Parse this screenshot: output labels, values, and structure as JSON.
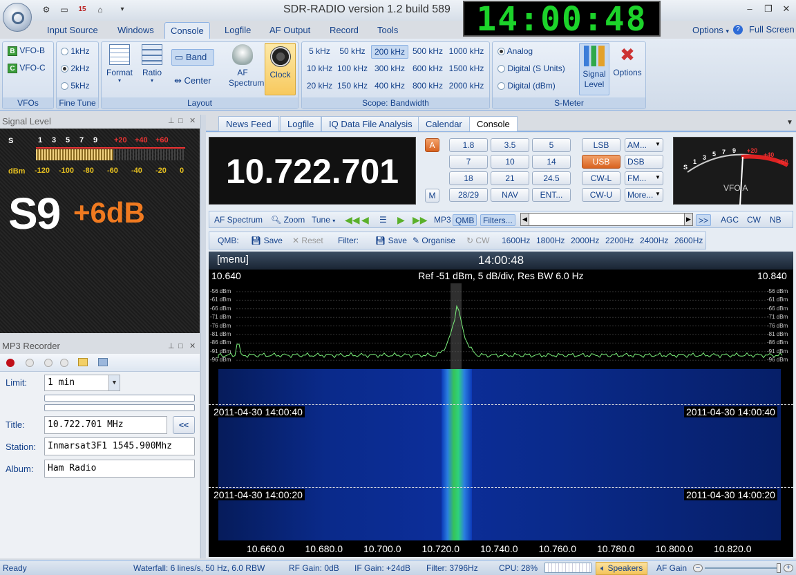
{
  "title_bar": {
    "title": "SDR-RADIO version 1.2  build 589",
    "clock": "14:00:48",
    "quick_access_icons": [
      "gear-icon",
      "monitor-icon",
      "calendar-icon",
      "home-icon",
      "dropdown-icon"
    ]
  },
  "menu": {
    "tabs": [
      "Input Source",
      "Windows",
      "Console",
      "Logfile",
      "AF Output",
      "Record",
      "Tools"
    ],
    "active": "Console",
    "options": "Options",
    "full_screen": "Full Screen"
  },
  "ribbon": {
    "vfos": {
      "items": [
        "VFO-B",
        "VFO-C"
      ],
      "caption": "VFOs"
    },
    "fine_tune": {
      "items": [
        "1kHz",
        "2kHz",
        "5kHz"
      ],
      "selected": "2kHz",
      "caption": "Fine Tune"
    },
    "layout": {
      "format": "Format",
      "ratio": "Ratio",
      "band": "Band",
      "center": "Center",
      "af_spectrum": "AF Spectrum",
      "clock": "Clock",
      "caption": "Layout"
    },
    "scope": {
      "items": [
        "5 kHz",
        "50 kHz",
        "200 kHz",
        "500 kHz",
        "1000 kHz",
        "10 kHz",
        "100 kHz",
        "300 kHz",
        "600 kHz",
        "1500 kHz",
        "20 kHz",
        "150 kHz",
        "400 kHz",
        "800 kHz",
        "2000 kHz"
      ],
      "selected": "200 kHz",
      "caption": "Scope: Bandwidth"
    },
    "smeter": {
      "items": [
        "Analog",
        "Digital (S Units)",
        "Digital (dBm)"
      ],
      "selected": "Analog",
      "signal_level": "Signal Level",
      "options": "Options",
      "caption": "S-Meter"
    }
  },
  "signal_panel": {
    "header": "Signal Level",
    "scale_s": "S",
    "s_ticks": [
      "1",
      "3",
      "5",
      "7",
      "9"
    ],
    "plus_ticks": [
      "+20",
      "+40",
      "+60"
    ],
    "dbm_label": "dBm",
    "dbm_ticks": [
      "-120",
      "-100",
      "-80",
      "-60",
      "-40",
      "-20",
      "0"
    ],
    "level_main": "S9",
    "level_extra": "+6dB",
    "level_fraction": 0.52
  },
  "mp3": {
    "header": "MP3 Recorder",
    "limit_label": "Limit:",
    "limit_value": "1 min",
    "title_label": "Title:",
    "title_value": "10.722.701 MHz",
    "title_btn": "<<",
    "station_label": "Station:",
    "station_value": "Inmarsat3F1 1545.900Mhz",
    "album_label": "Album:",
    "album_value": "Ham Radio"
  },
  "doc_tabs": [
    "News Feed",
    "Logfile",
    "IQ Data File Analysis",
    "Calendar",
    "Console"
  ],
  "doc_active": "Console",
  "console": {
    "frequency": "10.722.701",
    "vfo_a_btn": "A",
    "m_btn": "M",
    "bands": [
      "1.8",
      "3.5",
      "5",
      "7",
      "10",
      "14",
      "18",
      "21",
      "24.5",
      "28/29",
      "NAV",
      "ENT..."
    ],
    "modes": [
      "LSB",
      "AM...",
      "USB",
      "DSB",
      "CW-L",
      "FM...",
      "CW-U",
      "More..."
    ],
    "active_mode": "USB",
    "meter_label": "VFO A",
    "meter_ticks": [
      "S",
      "1",
      "3",
      "5",
      "7",
      "9",
      "+20",
      "+40",
      "+60"
    ]
  },
  "toolbar1": {
    "af_spectrum": "AF Spectrum",
    "zoom": "Zoom",
    "tune": "Tune",
    "mp3": "MP3",
    "qmb": "QMB",
    "filters": "Filters...",
    "more": ">>",
    "agc": "AGC",
    "cw": "CW",
    "nb": "NB"
  },
  "toolbar2": {
    "qmb": "QMB:",
    "save": "Save",
    "reset": "Reset",
    "filter": "Filter:",
    "save2": "Save",
    "organise": "Organise",
    "cw": "CW",
    "filters": [
      "1600Hz",
      "1800Hz",
      "2000Hz",
      "2200Hz",
      "2400Hz",
      "2600Hz"
    ]
  },
  "spectrum": {
    "menu": "[menu]",
    "time": "14:00:48",
    "left_freq": "10.640",
    "right_freq": "10.840",
    "ref": "Ref -51 dBm,  5 dB/div,  Res BW 6.0 Hz",
    "db_ticks": [
      "-56 dBm",
      "-61 dBm",
      "-66 dBm",
      "-71 dBm",
      "-76 dBm",
      "-81 dBm",
      "-86 dBm",
      "-91 dBm",
      "-96 dBm"
    ],
    "wf_time1": "2011-04-30  14:00:40",
    "wf_time2": "2011-04-30  14:00:20",
    "axis": [
      "10.660.0",
      "10.680.0",
      "10.700.0",
      "10.720.0",
      "10.740.0",
      "10.760.0",
      "10.780.0",
      "10.800.0",
      "10.820.0"
    ]
  },
  "status": {
    "ready": "Ready",
    "waterfall": "Waterfall: 6 lines/s, 50 Hz, 6.0 RBW",
    "rf_gain": "RF Gain: 0dB",
    "if_gain": "IF Gain: +24dB",
    "filter": "Filter: 3796Hz",
    "cpu": "CPU: 28%",
    "speakers": "Speakers",
    "af_gain": "AF Gain"
  }
}
